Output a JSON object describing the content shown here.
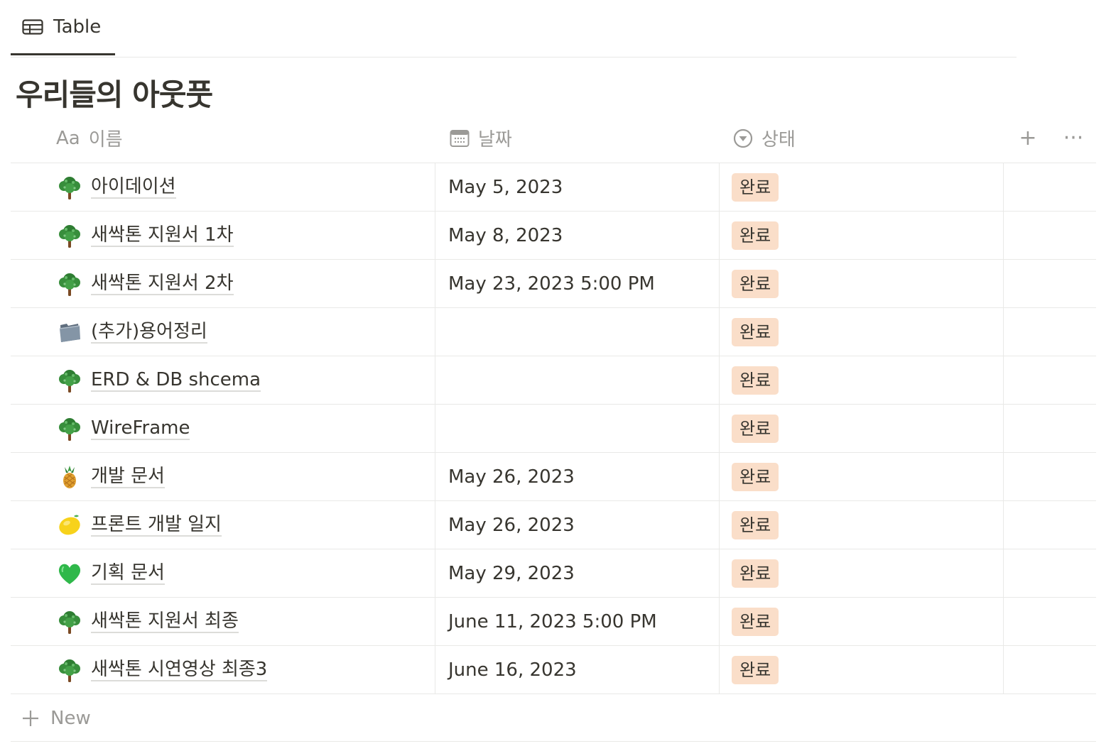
{
  "view_tab": {
    "label": "Table",
    "icon": "table-icon"
  },
  "page_title": "우리들의 아웃풋",
  "columns": [
    {
      "label": "이름",
      "icon": "text-property-icon",
      "icon_text": "Aa"
    },
    {
      "label": "날짜",
      "icon": "calendar-icon"
    },
    {
      "label": "상태",
      "icon": "status-icon"
    }
  ],
  "header_actions": {
    "add": "+",
    "more": "···"
  },
  "rows": [
    {
      "emoji": "tree",
      "title": "아이데이션",
      "date": "May 5, 2023",
      "status": "완료"
    },
    {
      "emoji": "tree",
      "title": "새싹톤 지원서 1차",
      "date": "May 8, 2023",
      "status": "완료"
    },
    {
      "emoji": "tree",
      "title": "새싹톤 지원서 2차",
      "date": "May 23, 2023 5:00 PM",
      "status": "완료"
    },
    {
      "emoji": "folder",
      "title": "(추가)용어정리",
      "date": "",
      "status": "완료"
    },
    {
      "emoji": "tree",
      "title": "ERD & DB shcema",
      "date": "",
      "status": "완료"
    },
    {
      "emoji": "tree",
      "title": "WireFrame",
      "date": "",
      "status": "완료"
    },
    {
      "emoji": "pineapple",
      "title": "개발 문서",
      "date": "May 26, 2023",
      "status": "완료"
    },
    {
      "emoji": "lemon",
      "title": "프론트 개발 일지",
      "date": "May 26, 2023",
      "status": "완료"
    },
    {
      "emoji": "green-heart",
      "title": "기획 문서",
      "date": "May 29, 2023",
      "status": "완료"
    },
    {
      "emoji": "tree",
      "title": "새싹톤 지원서 최종",
      "date": "June 11, 2023 5:00 PM",
      "status": "완료"
    },
    {
      "emoji": "tree",
      "title": "새싹톤 시연영상 최종3",
      "date": "June 16, 2023",
      "status": "완료"
    }
  ],
  "new_row_label": "New",
  "colors": {
    "status_done_bg": "#fadec9",
    "text": "#37352f",
    "muted": "#9b9a97",
    "border": "#e9e9e7"
  }
}
